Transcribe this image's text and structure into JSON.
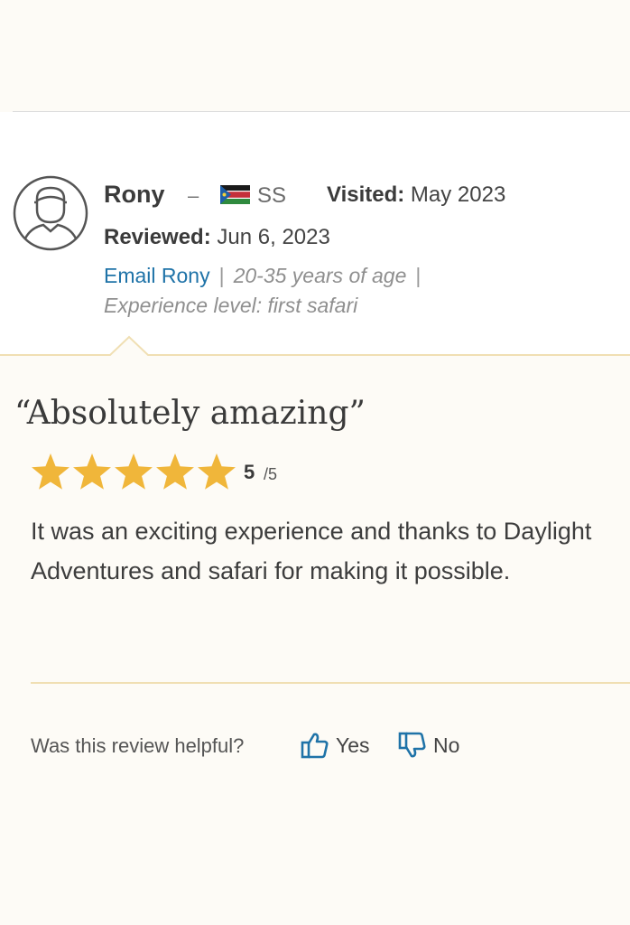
{
  "reviewer": {
    "name": "Rony",
    "dash": "–",
    "country_code": "SS",
    "visited_label": "Visited:",
    "visited_value": "May 2023",
    "reviewed_label": "Reviewed:",
    "reviewed_value": "Jun 6, 2023",
    "email_link": "Email Rony",
    "separator": "|",
    "age_range": "20-35 years of age",
    "experience": "Experience level: first safari"
  },
  "review": {
    "title": "“Absolutely amazing”",
    "rating": "5",
    "rating_max": "/5",
    "rating_value": 5,
    "body": "It was an exciting experience and thanks to Daylight Adventures and safari for making it possible."
  },
  "feedback": {
    "question": "Was this review helpful?",
    "yes_label": "Yes",
    "no_label": "No"
  },
  "colors": {
    "background": "#fdfbf6",
    "panel": "#ffffff",
    "star": "#f0b63a",
    "link": "#1f73a8",
    "accent_line": "#f0dfb3"
  },
  "icons": {
    "avatar": "user-avatar-icon",
    "flag": "south-sudan-flag-icon",
    "star": "star-icon",
    "thumbs_up": "thumbs-up-icon",
    "thumbs_down": "thumbs-down-icon"
  }
}
